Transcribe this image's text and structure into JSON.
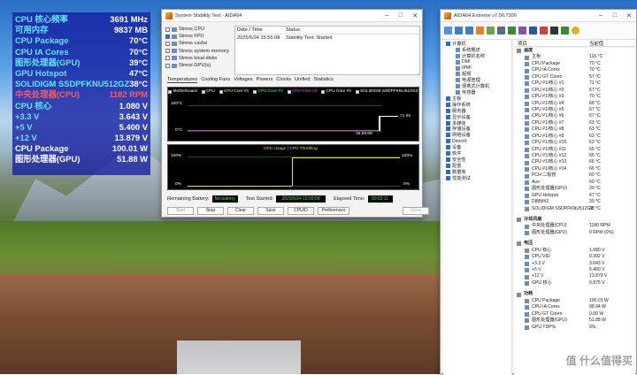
{
  "osd": [
    {
      "label": "CPU 核心频率",
      "value": "3691 MHz",
      "color": "#5ee8ff"
    },
    {
      "label": "可用内存",
      "value": "9837 MB",
      "color": "#5ee8ff"
    },
    {
      "label": "CPU Package",
      "value": "70°C",
      "color": "#5ee8ff"
    },
    {
      "label": "CPU IA Cores",
      "value": "70°C",
      "color": "#5ee8ff"
    },
    {
      "label": "图形处理器(GPU)",
      "value": "39°C",
      "color": "#5ee8ff"
    },
    {
      "label": "GPU Hotspot",
      "value": "47°C",
      "color": "#5ee8ff"
    },
    {
      "label": "SOLIDIGM SSDPFKNU512GZ",
      "value": "38°C",
      "color": "#5ee8ff"
    },
    {
      "label": "中央处理器(CPU)",
      "value": "1182 RPM",
      "color": "#ff5a5a"
    },
    {
      "label": "CPU 核心",
      "value": "1.080 V",
      "color": "#5ee8ff"
    },
    {
      "label": "+3.3 V",
      "value": "3.643 V",
      "color": "#5ee8ff"
    },
    {
      "label": "+5 V",
      "value": "5.400 V",
      "color": "#5ee8ff"
    },
    {
      "label": "+12 V",
      "value": "13.879 V",
      "color": "#5ee8ff"
    },
    {
      "label": "CPU Package",
      "value": "100.01 W",
      "color": "#ffffff"
    },
    {
      "label": "图形处理器(GPU)",
      "value": "51.88 W",
      "color": "#ffffff"
    }
  ],
  "sst": {
    "title": "System Stability Test - AIDA64",
    "options": [
      {
        "label": "Stress CPU",
        "on": false
      },
      {
        "label": "Stress FPU",
        "on": true
      },
      {
        "label": "Stress cache",
        "on": false
      },
      {
        "label": "Stress system memory",
        "on": false
      },
      {
        "label": "Stress local disks",
        "on": false
      },
      {
        "label": "Stress GPU(s)",
        "on": false
      }
    ],
    "log_headers": [
      "Date / Time",
      "Status"
    ],
    "log_rows": [
      [
        "2025/5/24 15:55:08",
        "Stability Test: Started"
      ]
    ],
    "tabs": [
      "Temperatures",
      "Cooling Fans",
      "Voltages",
      "Powers",
      "Clocks",
      "Unified",
      "Statistics"
    ],
    "legend": [
      "Motherboard",
      "CPU",
      "CPU Core #1",
      "CPU Core #2",
      "CPU Core #3",
      "CPU Core #4",
      "SOLIDIGM SSDPFKNU512GZ"
    ],
    "legend_colors": [
      "#ffffff",
      "#ffffff",
      "#ffff40",
      "#40ff40",
      "#ff40ff",
      "#ffffff",
      "#ffffff"
    ],
    "g1_top": "100°C",
    "g1_bottom": "0°C",
    "g1_time": "15:55:08",
    "g1_val": "71 66",
    "g2_title": "CPU Usage | CPU Throttling",
    "g2_top_l": "100%",
    "g2_bot_l": "0%",
    "g2_top_r": "100%",
    "g2_bot_r": "0%",
    "battery_label": "Remaining Battery:",
    "battery": "No battery",
    "started_label": "Test Started:",
    "started": "2025/5/24 15:55:08",
    "elapsed_label": "Elapsed Time:",
    "elapsed": "00:02:11",
    "buttons": {
      "start": "Start",
      "stop": "Stop",
      "clear": "Clear",
      "save": "Save",
      "cpuid": "CPUID",
      "prefs": "Preferences",
      "close": "Close"
    }
  },
  "aida": {
    "title": "AIDA64 Extreme v7.00.7300",
    "tree": [
      {
        "label": "计算机",
        "lvl": 0
      },
      {
        "label": "系统概述",
        "lvl": 1
      },
      {
        "label": "计算机名称",
        "lvl": 1
      },
      {
        "label": "DMI",
        "lvl": 1
      },
      {
        "label": "IPMI",
        "lvl": 1
      },
      {
        "label": "超频",
        "lvl": 1
      },
      {
        "label": "电源管理",
        "lvl": 1
      },
      {
        "label": "便携式计算机",
        "lvl": 1
      },
      {
        "label": "传感器",
        "lvl": 1
      },
      {
        "label": "主板",
        "lvl": 0
      },
      {
        "label": "操作系统",
        "lvl": 0
      },
      {
        "label": "服务器",
        "lvl": 0
      },
      {
        "label": "显示设备",
        "lvl": 0
      },
      {
        "label": "多媒体",
        "lvl": 0
      },
      {
        "label": "存储设备",
        "lvl": 0
      },
      {
        "label": "网络设备",
        "lvl": 0
      },
      {
        "label": "DirectX",
        "lvl": 0
      },
      {
        "label": "设备",
        "lvl": 0
      },
      {
        "label": "软件",
        "lvl": 0
      },
      {
        "label": "安全性",
        "lvl": 0
      },
      {
        "label": "配置",
        "lvl": 0
      },
      {
        "label": "数据库",
        "lvl": 0
      },
      {
        "label": "性能测试",
        "lvl": 0
      }
    ],
    "col_item": "项目",
    "col_value": "当前值",
    "rows": [
      {
        "n": "温度",
        "v": "",
        "sec": true
      },
      {
        "n": "主板",
        "v": "116 °C"
      },
      {
        "n": "CPU Package",
        "v": "70 °C"
      },
      {
        "n": "CPU IA Cores",
        "v": "70 °C"
      },
      {
        "n": "CPU GT Cores",
        "v": "57 °C"
      },
      {
        "n": "CPU #1/核心 #1",
        "v": "71 °C"
      },
      {
        "n": "CPU #1/核心 #2",
        "v": "67 °C"
      },
      {
        "n": "CPU #1/核心 #3",
        "v": "70 °C"
      },
      {
        "n": "CPU #1/核心 #4",
        "v": "68 °C"
      },
      {
        "n": "CPU #1/核心 #5",
        "v": "67 °C"
      },
      {
        "n": "CPU #1/核心 #6",
        "v": "67 °C"
      },
      {
        "n": "CPU #1/核心 #7",
        "v": "63 °C"
      },
      {
        "n": "CPU #1/核心 #8",
        "v": "63 °C"
      },
      {
        "n": "CPU #1/核心 #9",
        "v": "63 °C"
      },
      {
        "n": "CPU #1/核心 #10",
        "v": "63 °C"
      },
      {
        "n": "CPU #1/核心 #11",
        "v": "66 °C"
      },
      {
        "n": "CPU #1/核心 #12",
        "v": "66 °C"
      },
      {
        "n": "CPU #1/核心 #13",
        "v": "66 °C"
      },
      {
        "n": "CPU #1/核心 #14",
        "v": "66 °C"
      },
      {
        "n": "PCH 二极管",
        "v": "60 °C"
      },
      {
        "n": "Aux",
        "v": "60 °C"
      },
      {
        "n": "图形处理器(GPU)",
        "v": "39 °C"
      },
      {
        "n": "GPU Hotspot",
        "v": "47 °C"
      },
      {
        "n": "DIMM#2",
        "v": "39 °C"
      },
      {
        "n": "SOLIDIGM SSDPFKNU512GZ",
        "v": "38 °C"
      },
      {
        "n": "",
        "v": "",
        "gap": true
      },
      {
        "n": "冷却风扇",
        "v": "",
        "sec": true
      },
      {
        "n": "中央处理器(CPU)",
        "v": "1180 RPM"
      },
      {
        "n": "图形处理器(GPU)",
        "v": "0 RPM  (0%)"
      },
      {
        "n": "",
        "v": "",
        "gap": true
      },
      {
        "n": "电压",
        "v": "",
        "sec": true
      },
      {
        "n": "CPU 核心",
        "v": "1.080 V"
      },
      {
        "n": "CPU VID",
        "v": "0.992 V"
      },
      {
        "n": "+3.3 V",
        "v": "3.643 V"
      },
      {
        "n": "+5 V",
        "v": "5.400 V"
      },
      {
        "n": "+12 V",
        "v": "13.879 V"
      },
      {
        "n": "GPU 核心",
        "v": "0.875 V"
      },
      {
        "n": "",
        "v": "",
        "gap": true
      },
      {
        "n": "功耗",
        "v": "",
        "sec": true
      },
      {
        "n": "CPU Package",
        "v": "100.01 W"
      },
      {
        "n": "CPU IA Cores",
        "v": "98.94 W"
      },
      {
        "n": "CPU GT Cores",
        "v": "0.00 W"
      },
      {
        "n": "图形处理器(GPU)",
        "v": "51.88 W"
      },
      {
        "n": "GPU TDP%",
        "v": "0%"
      }
    ],
    "watermark": "值 什么值得买"
  }
}
